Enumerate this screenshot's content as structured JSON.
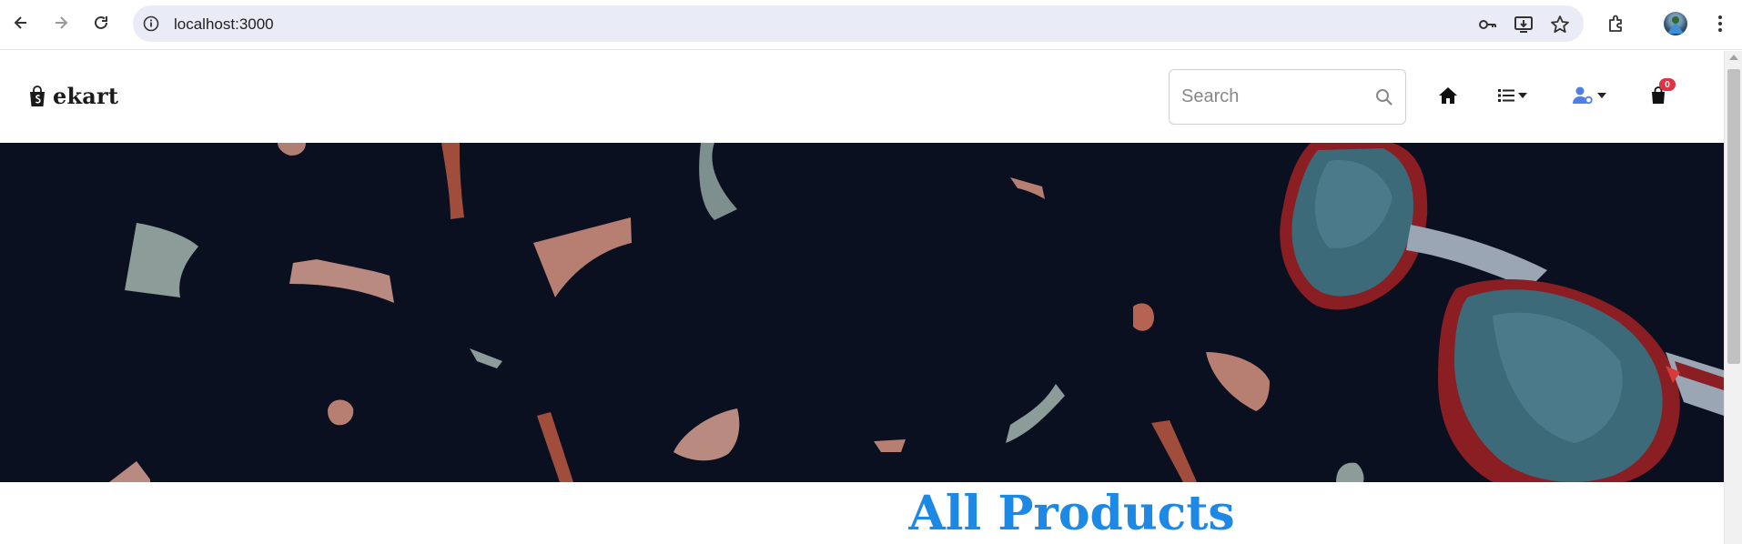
{
  "browser": {
    "url": "localhost:3000",
    "icons": [
      "back-arrow-icon",
      "forward-arrow-icon",
      "reload-icon",
      "info-icon",
      "key-icon",
      "install-icon",
      "star-icon",
      "extensions-icon",
      "kebab-menu-icon"
    ]
  },
  "site": {
    "brand": "ekart",
    "search_placeholder": "Search",
    "cart_count": "0",
    "page_title": "All Products"
  },
  "colors": {
    "banner_bg": "#0a1020",
    "title": "#1e88e5",
    "badge": "#dc3545",
    "user_icon": "#4f7fe0"
  }
}
